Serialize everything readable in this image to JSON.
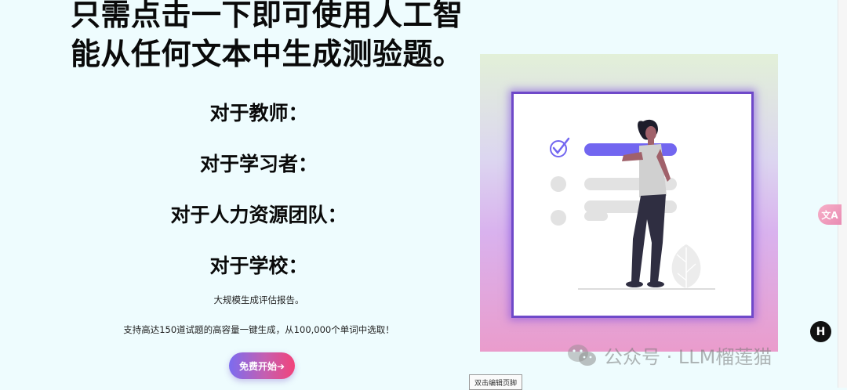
{
  "hero": {
    "title_line1": "只需点击一下即可使用人工智",
    "title_line2": "能从任何文本中生成测验题。"
  },
  "audiences": [
    {
      "label": "对于教师："
    },
    {
      "label": "对于学习者："
    },
    {
      "label": "对于人力资源团队："
    },
    {
      "label": "对于学校："
    }
  ],
  "notes": {
    "report": "大规模生成评估报告。",
    "capacity": "支持高达150道试题的高容量一键生成，从100,000个单词中选取！"
  },
  "cta": {
    "label": "免费开始➔"
  },
  "floating": {
    "translate_label": "文A",
    "h_label": "H"
  },
  "watermark": {
    "text": "公众号 · LLM榴莲猫"
  },
  "footer": {
    "edit_label": "双击编辑页脚"
  },
  "colors": {
    "background": "#eefcfe",
    "accent_purple": "#6f49c9",
    "cta_start": "#7b6cf0",
    "cta_end": "#f2437a",
    "checklist_bar": "#7266f0"
  },
  "icons": [
    "wechat-icon",
    "translate-icon",
    "h-icon",
    "check-circle-icon",
    "leaf-icon"
  ]
}
